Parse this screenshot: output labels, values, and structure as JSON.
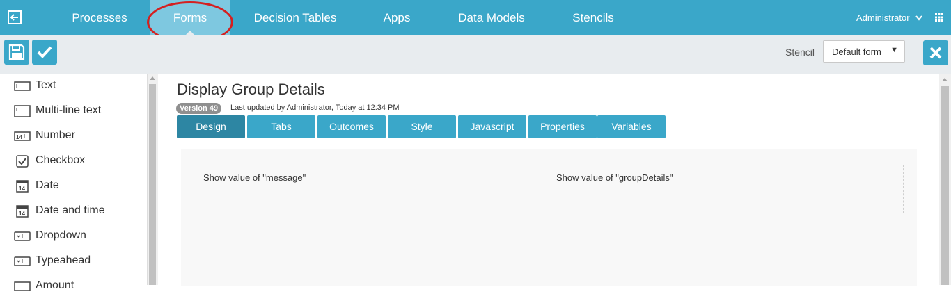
{
  "nav": {
    "items": [
      "Processes",
      "Forms",
      "Decision Tables",
      "Apps",
      "Data Models",
      "Stencils"
    ],
    "active": "Forms",
    "user": "Administrator"
  },
  "toolbar": {
    "stencil_label": "Stencil",
    "stencil_value": "Default form"
  },
  "palette": {
    "items": [
      {
        "label": "Text",
        "icon": "text-field-icon"
      },
      {
        "label": "Multi-line text",
        "icon": "multiline-text-icon"
      },
      {
        "label": "Number",
        "icon": "number-field-icon"
      },
      {
        "label": "Checkbox",
        "icon": "checkbox-icon"
      },
      {
        "label": "Date",
        "icon": "calendar-icon"
      },
      {
        "label": "Date and time",
        "icon": "calendar-icon"
      },
      {
        "label": "Dropdown",
        "icon": "dropdown-icon"
      },
      {
        "label": "Typeahead",
        "icon": "typeahead-icon"
      },
      {
        "label": "Amount",
        "icon": "amount-icon"
      }
    ]
  },
  "form": {
    "title": "Display Group Details",
    "version": "Version 49",
    "updated": "Last updated by Administrator, Today at 12:34 PM",
    "tabs": [
      "Design",
      "Tabs",
      "Outcomes",
      "Style",
      "Javascript",
      "Properties",
      "Variables"
    ],
    "active_tab": "Design",
    "fields": [
      "Show value of \"message\"",
      "Show value of \"groupDetails\""
    ]
  },
  "colors": {
    "brand": "#3aa7c9",
    "active_tab": "#2d86a3",
    "highlight_ring": "#d42020"
  }
}
